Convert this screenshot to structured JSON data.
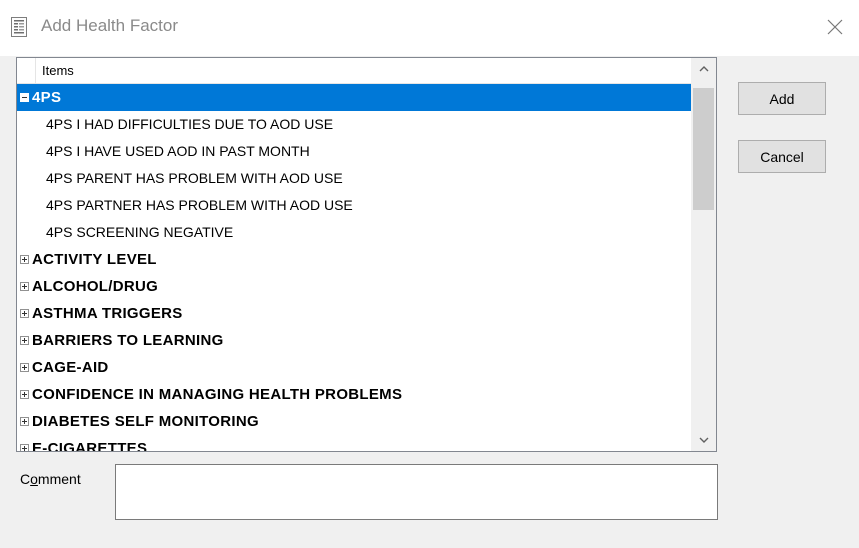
{
  "window": {
    "title": "Add Health Factor",
    "icon": "document-form-icon",
    "close_icon": "close-icon"
  },
  "list": {
    "header": "Items",
    "selected_color": "#0078d7",
    "rows": [
      {
        "label": "4PS",
        "type": "parent",
        "expanded": true,
        "selected": true
      },
      {
        "label": "4PS I HAD DIFFICULTIES DUE TO AOD USE",
        "type": "child"
      },
      {
        "label": "4PS I HAVE USED AOD IN PAST MONTH",
        "type": "child"
      },
      {
        "label": "4PS PARENT HAS PROBLEM WITH AOD USE",
        "type": "child"
      },
      {
        "label": "4PS PARTNER HAS PROBLEM WITH AOD USE",
        "type": "child"
      },
      {
        "label": "4PS SCREENING NEGATIVE",
        "type": "child"
      },
      {
        "label": "ACTIVITY LEVEL",
        "type": "parent",
        "expanded": false
      },
      {
        "label": "ALCOHOL/DRUG",
        "type": "parent",
        "expanded": false
      },
      {
        "label": "ASTHMA TRIGGERS",
        "type": "parent",
        "expanded": false
      },
      {
        "label": "BARRIERS TO LEARNING",
        "type": "parent",
        "expanded": false
      },
      {
        "label": "CAGE-AID",
        "type": "parent",
        "expanded": false
      },
      {
        "label": "CONFIDENCE IN MANAGING HEALTH PROBLEMS",
        "type": "parent",
        "expanded": false
      },
      {
        "label": "DIABETES SELF MONITORING",
        "type": "parent",
        "expanded": false
      },
      {
        "label": "E-CIGARETTES",
        "type": "parent",
        "expanded": false
      }
    ]
  },
  "buttons": {
    "add": "Add",
    "cancel": "Cancel"
  },
  "comment": {
    "label_prefix": "C",
    "label_underlined": "o",
    "label_suffix": "mment",
    "value": ""
  }
}
